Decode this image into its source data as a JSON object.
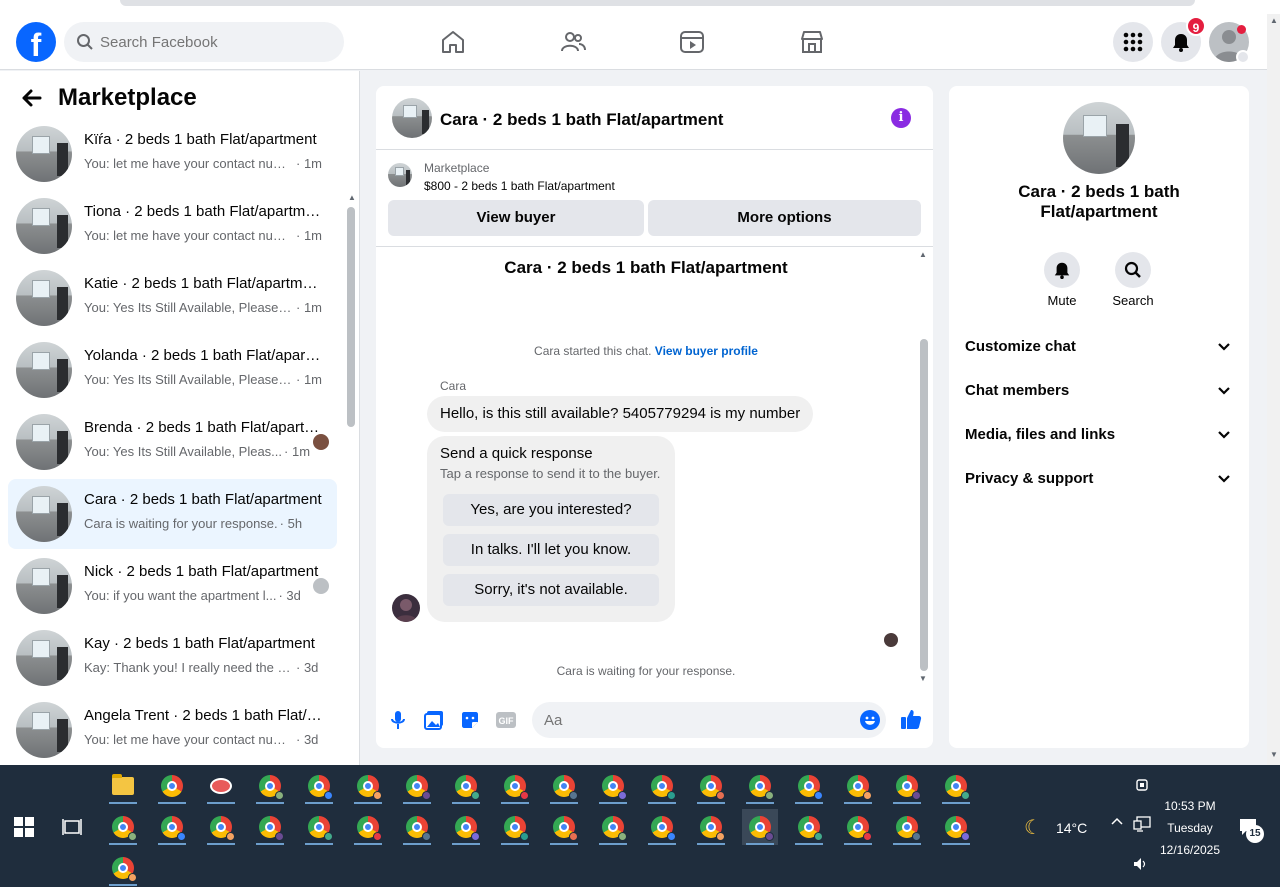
{
  "topnav": {
    "search_placeholder": "Search Facebook",
    "notifications_count": "9"
  },
  "sidebar": {
    "title": "Marketplace",
    "conversations": [
      {
        "name": "Kïŕa · 2 beds 1 bath Flat/apartment",
        "message": "You: let me have your contact num...",
        "time": "· 1m",
        "side": "",
        "active": false
      },
      {
        "name": "Tiona · 2 beds 1 bath Flat/apartment",
        "message": "You: let me have your contact num...",
        "time": "· 1m",
        "side": "",
        "active": false
      },
      {
        "name": "Katie · 2 beds 1 bath Flat/apartment",
        "message": "You: Yes Its Still Available, Please S...",
        "time": "· 1m",
        "side": "",
        "active": false
      },
      {
        "name": "Yolanda · 2 beds 1 bath Flat/apartment",
        "message": "You: Yes Its Still Available, Please S...",
        "time": "· 1m",
        "side": "",
        "active": false
      },
      {
        "name": "Brenda · 2 beds 1 bath Flat/apartment",
        "message": "You: Yes Its Still Available, Pleas...",
        "time": "· 1m",
        "side": "photo",
        "active": false
      },
      {
        "name": "Cara · 2 beds 1 bath Flat/apartment",
        "message": "Cara is waiting for your response.",
        "time": "· 5h",
        "side": "",
        "active": true
      },
      {
        "name": "Nick · 2 beds 1 bath Flat/apartment",
        "message": "You: if you want the apartment l...",
        "time": "· 3d",
        "side": "default",
        "active": false
      },
      {
        "name": "Kay · 2 beds 1 bath Flat/apartment",
        "message": "Kay: Thank you! I really need the pl...",
        "time": "· 3d",
        "side": "",
        "active": false
      },
      {
        "name": "Angela Trent · 2 beds 1 bath Flat/apartment",
        "message": "You: let me have your contact num...",
        "time": "· 3d",
        "side": "",
        "active": false
      }
    ]
  },
  "chat": {
    "title": "Cara · 2 beds 1 bath Flat/apartment",
    "marketplace_label": "Marketplace",
    "listing": "$800 - 2 beds 1 bath Flat/apartment",
    "view_buyer": "View buyer",
    "more_options": "More options",
    "convo_title": "Cara · 2 beds 1 bath Flat/apartment",
    "started_text": "Cara started this chat.",
    "view_profile": "View buyer profile",
    "sender": "Cara",
    "message": "Hello, is this still available? 5405779294 is my number",
    "quick_heading": "Send a quick response",
    "quick_sub": "Tap a response to send it to the buyer.",
    "quick_replies": [
      "Yes, are you interested?",
      "In talks. I'll let you know.",
      "Sorry, it's not available."
    ],
    "waiting": "Cara is waiting for your response.",
    "input_placeholder": "Aa"
  },
  "info": {
    "name": "Cara · 2 beds 1 bath Flat/apartment",
    "mute": "Mute",
    "search": "Search",
    "sections": [
      "Customize chat",
      "Chat members",
      "Media, files and links",
      "Privacy & support"
    ]
  },
  "taskbar": {
    "temperature": "14°C",
    "time": "10:53 PM",
    "day": "Tuesday",
    "date": "12/16/2025",
    "notifications": "15"
  },
  "colors": {
    "brand": "#0866ff",
    "active_bg": "#ebf5ff",
    "badge": "#e41e3f",
    "info_icon": "#8a2be2"
  }
}
